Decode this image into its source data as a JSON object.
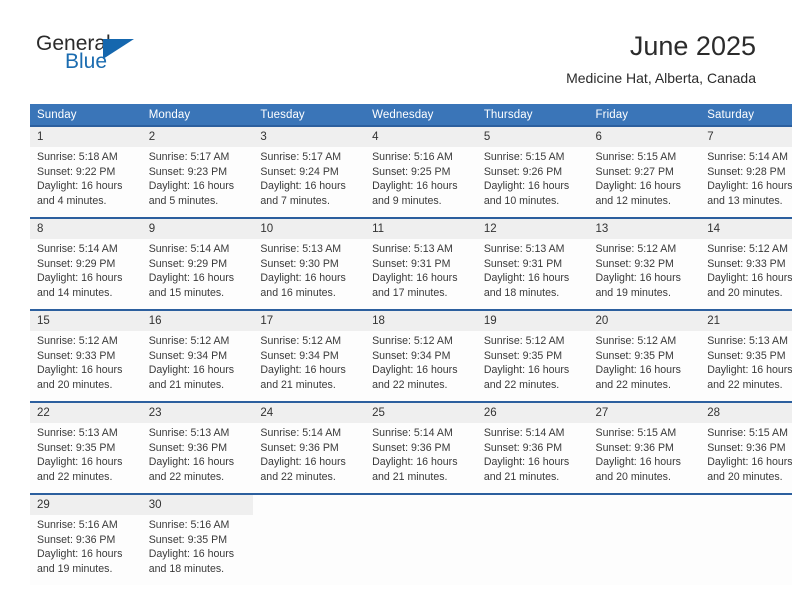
{
  "brand": {
    "word_one": "General",
    "word_two": "Blue",
    "triangle_icon": "triangle-icon",
    "accent_color": "#1567ae"
  },
  "header": {
    "title": "June 2025",
    "location": "Medicine Hat, Alberta, Canada"
  },
  "theme": {
    "header_row_bg": "#3a75b8",
    "row_border": "#2c5f9e",
    "daynum_bg": "#efefef",
    "text": "#333333"
  },
  "calendar": {
    "weekday_headers": [
      "Sunday",
      "Monday",
      "Tuesday",
      "Wednesday",
      "Thursday",
      "Friday",
      "Saturday"
    ],
    "labels": {
      "sunrise": "Sunrise:",
      "sunset": "Sunset:",
      "daylight": "Daylight:"
    },
    "weeks": [
      [
        {
          "day": "1",
          "sunrise": "Sunrise: 5:18 AM",
          "sunset": "Sunset: 9:22 PM",
          "daylight": "Daylight: 16 hours and 4 minutes."
        },
        {
          "day": "2",
          "sunrise": "Sunrise: 5:17 AM",
          "sunset": "Sunset: 9:23 PM",
          "daylight": "Daylight: 16 hours and 5 minutes."
        },
        {
          "day": "3",
          "sunrise": "Sunrise: 5:17 AM",
          "sunset": "Sunset: 9:24 PM",
          "daylight": "Daylight: 16 hours and 7 minutes."
        },
        {
          "day": "4",
          "sunrise": "Sunrise: 5:16 AM",
          "sunset": "Sunset: 9:25 PM",
          "daylight": "Daylight: 16 hours and 9 minutes."
        },
        {
          "day": "5",
          "sunrise": "Sunrise: 5:15 AM",
          "sunset": "Sunset: 9:26 PM",
          "daylight": "Daylight: 16 hours and 10 minutes."
        },
        {
          "day": "6",
          "sunrise": "Sunrise: 5:15 AM",
          "sunset": "Sunset: 9:27 PM",
          "daylight": "Daylight: 16 hours and 12 minutes."
        },
        {
          "day": "7",
          "sunrise": "Sunrise: 5:14 AM",
          "sunset": "Sunset: 9:28 PM",
          "daylight": "Daylight: 16 hours and 13 minutes."
        }
      ],
      [
        {
          "day": "8",
          "sunrise": "Sunrise: 5:14 AM",
          "sunset": "Sunset: 9:29 PM",
          "daylight": "Daylight: 16 hours and 14 minutes."
        },
        {
          "day": "9",
          "sunrise": "Sunrise: 5:14 AM",
          "sunset": "Sunset: 9:29 PM",
          "daylight": "Daylight: 16 hours and 15 minutes."
        },
        {
          "day": "10",
          "sunrise": "Sunrise: 5:13 AM",
          "sunset": "Sunset: 9:30 PM",
          "daylight": "Daylight: 16 hours and 16 minutes."
        },
        {
          "day": "11",
          "sunrise": "Sunrise: 5:13 AM",
          "sunset": "Sunset: 9:31 PM",
          "daylight": "Daylight: 16 hours and 17 minutes."
        },
        {
          "day": "12",
          "sunrise": "Sunrise: 5:13 AM",
          "sunset": "Sunset: 9:31 PM",
          "daylight": "Daylight: 16 hours and 18 minutes."
        },
        {
          "day": "13",
          "sunrise": "Sunrise: 5:12 AM",
          "sunset": "Sunset: 9:32 PM",
          "daylight": "Daylight: 16 hours and 19 minutes."
        },
        {
          "day": "14",
          "sunrise": "Sunrise: 5:12 AM",
          "sunset": "Sunset: 9:33 PM",
          "daylight": "Daylight: 16 hours and 20 minutes."
        }
      ],
      [
        {
          "day": "15",
          "sunrise": "Sunrise: 5:12 AM",
          "sunset": "Sunset: 9:33 PM",
          "daylight": "Daylight: 16 hours and 20 minutes."
        },
        {
          "day": "16",
          "sunrise": "Sunrise: 5:12 AM",
          "sunset": "Sunset: 9:34 PM",
          "daylight": "Daylight: 16 hours and 21 minutes."
        },
        {
          "day": "17",
          "sunrise": "Sunrise: 5:12 AM",
          "sunset": "Sunset: 9:34 PM",
          "daylight": "Daylight: 16 hours and 21 minutes."
        },
        {
          "day": "18",
          "sunrise": "Sunrise: 5:12 AM",
          "sunset": "Sunset: 9:34 PM",
          "daylight": "Daylight: 16 hours and 22 minutes."
        },
        {
          "day": "19",
          "sunrise": "Sunrise: 5:12 AM",
          "sunset": "Sunset: 9:35 PM",
          "daylight": "Daylight: 16 hours and 22 minutes."
        },
        {
          "day": "20",
          "sunrise": "Sunrise: 5:12 AM",
          "sunset": "Sunset: 9:35 PM",
          "daylight": "Daylight: 16 hours and 22 minutes."
        },
        {
          "day": "21",
          "sunrise": "Sunrise: 5:13 AM",
          "sunset": "Sunset: 9:35 PM",
          "daylight": "Daylight: 16 hours and 22 minutes."
        }
      ],
      [
        {
          "day": "22",
          "sunrise": "Sunrise: 5:13 AM",
          "sunset": "Sunset: 9:35 PM",
          "daylight": "Daylight: 16 hours and 22 minutes."
        },
        {
          "day": "23",
          "sunrise": "Sunrise: 5:13 AM",
          "sunset": "Sunset: 9:36 PM",
          "daylight": "Daylight: 16 hours and 22 minutes."
        },
        {
          "day": "24",
          "sunrise": "Sunrise: 5:14 AM",
          "sunset": "Sunset: 9:36 PM",
          "daylight": "Daylight: 16 hours and 22 minutes."
        },
        {
          "day": "25",
          "sunrise": "Sunrise: 5:14 AM",
          "sunset": "Sunset: 9:36 PM",
          "daylight": "Daylight: 16 hours and 21 minutes."
        },
        {
          "day": "26",
          "sunrise": "Sunrise: 5:14 AM",
          "sunset": "Sunset: 9:36 PM",
          "daylight": "Daylight: 16 hours and 21 minutes."
        },
        {
          "day": "27",
          "sunrise": "Sunrise: 5:15 AM",
          "sunset": "Sunset: 9:36 PM",
          "daylight": "Daylight: 16 hours and 20 minutes."
        },
        {
          "day": "28",
          "sunrise": "Sunrise: 5:15 AM",
          "sunset": "Sunset: 9:36 PM",
          "daylight": "Daylight: 16 hours and 20 minutes."
        }
      ],
      [
        {
          "day": "29",
          "sunrise": "Sunrise: 5:16 AM",
          "sunset": "Sunset: 9:36 PM",
          "daylight": "Daylight: 16 hours and 19 minutes."
        },
        {
          "day": "30",
          "sunrise": "Sunrise: 5:16 AM",
          "sunset": "Sunset: 9:35 PM",
          "daylight": "Daylight: 16 hours and 18 minutes."
        },
        {
          "day": "",
          "sunrise": "",
          "sunset": "",
          "daylight": ""
        },
        {
          "day": "",
          "sunrise": "",
          "sunset": "",
          "daylight": ""
        },
        {
          "day": "",
          "sunrise": "",
          "sunset": "",
          "daylight": ""
        },
        {
          "day": "",
          "sunrise": "",
          "sunset": "",
          "daylight": ""
        },
        {
          "day": "",
          "sunrise": "",
          "sunset": "",
          "daylight": ""
        }
      ]
    ]
  }
}
